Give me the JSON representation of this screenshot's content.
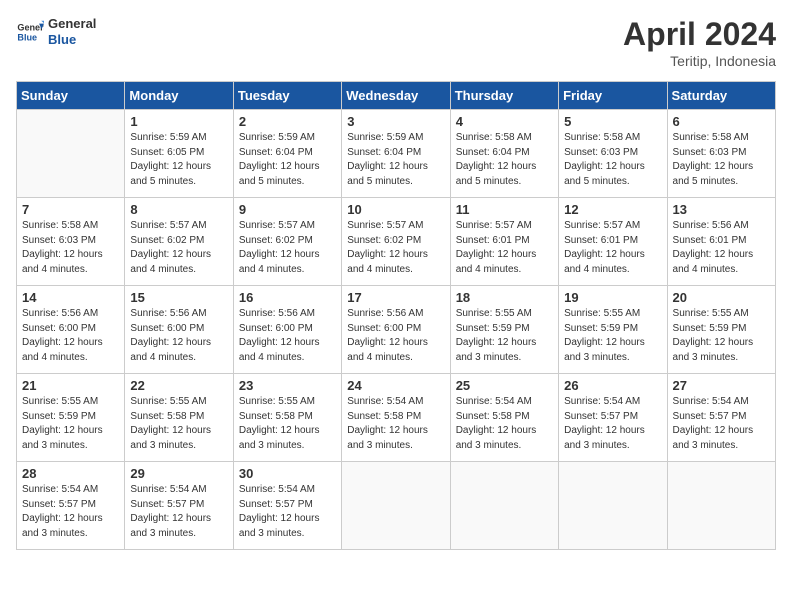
{
  "header": {
    "logo_line1": "General",
    "logo_line2": "Blue",
    "month": "April 2024",
    "location": "Teritip, Indonesia"
  },
  "weekdays": [
    "Sunday",
    "Monday",
    "Tuesday",
    "Wednesday",
    "Thursday",
    "Friday",
    "Saturday"
  ],
  "weeks": [
    [
      {
        "day": "",
        "empty": true
      },
      {
        "day": "1",
        "sunrise": "5:59 AM",
        "sunset": "6:05 PM",
        "daylight": "12 hours and 5 minutes."
      },
      {
        "day": "2",
        "sunrise": "5:59 AM",
        "sunset": "6:04 PM",
        "daylight": "12 hours and 5 minutes."
      },
      {
        "day": "3",
        "sunrise": "5:59 AM",
        "sunset": "6:04 PM",
        "daylight": "12 hours and 5 minutes."
      },
      {
        "day": "4",
        "sunrise": "5:58 AM",
        "sunset": "6:04 PM",
        "daylight": "12 hours and 5 minutes."
      },
      {
        "day": "5",
        "sunrise": "5:58 AM",
        "sunset": "6:03 PM",
        "daylight": "12 hours and 5 minutes."
      },
      {
        "day": "6",
        "sunrise": "5:58 AM",
        "sunset": "6:03 PM",
        "daylight": "12 hours and 5 minutes."
      }
    ],
    [
      {
        "day": "7",
        "sunrise": "5:58 AM",
        "sunset": "6:03 PM",
        "daylight": "12 hours and 4 minutes."
      },
      {
        "day": "8",
        "sunrise": "5:57 AM",
        "sunset": "6:02 PM",
        "daylight": "12 hours and 4 minutes."
      },
      {
        "day": "9",
        "sunrise": "5:57 AM",
        "sunset": "6:02 PM",
        "daylight": "12 hours and 4 minutes."
      },
      {
        "day": "10",
        "sunrise": "5:57 AM",
        "sunset": "6:02 PM",
        "daylight": "12 hours and 4 minutes."
      },
      {
        "day": "11",
        "sunrise": "5:57 AM",
        "sunset": "6:01 PM",
        "daylight": "12 hours and 4 minutes."
      },
      {
        "day": "12",
        "sunrise": "5:57 AM",
        "sunset": "6:01 PM",
        "daylight": "12 hours and 4 minutes."
      },
      {
        "day": "13",
        "sunrise": "5:56 AM",
        "sunset": "6:01 PM",
        "daylight": "12 hours and 4 minutes."
      }
    ],
    [
      {
        "day": "14",
        "sunrise": "5:56 AM",
        "sunset": "6:00 PM",
        "daylight": "12 hours and 4 minutes."
      },
      {
        "day": "15",
        "sunrise": "5:56 AM",
        "sunset": "6:00 PM",
        "daylight": "12 hours and 4 minutes."
      },
      {
        "day": "16",
        "sunrise": "5:56 AM",
        "sunset": "6:00 PM",
        "daylight": "12 hours and 4 minutes."
      },
      {
        "day": "17",
        "sunrise": "5:56 AM",
        "sunset": "6:00 PM",
        "daylight": "12 hours and 4 minutes."
      },
      {
        "day": "18",
        "sunrise": "5:55 AM",
        "sunset": "5:59 PM",
        "daylight": "12 hours and 3 minutes."
      },
      {
        "day": "19",
        "sunrise": "5:55 AM",
        "sunset": "5:59 PM",
        "daylight": "12 hours and 3 minutes."
      },
      {
        "day": "20",
        "sunrise": "5:55 AM",
        "sunset": "5:59 PM",
        "daylight": "12 hours and 3 minutes."
      }
    ],
    [
      {
        "day": "21",
        "sunrise": "5:55 AM",
        "sunset": "5:59 PM",
        "daylight": "12 hours and 3 minutes."
      },
      {
        "day": "22",
        "sunrise": "5:55 AM",
        "sunset": "5:58 PM",
        "daylight": "12 hours and 3 minutes."
      },
      {
        "day": "23",
        "sunrise": "5:55 AM",
        "sunset": "5:58 PM",
        "daylight": "12 hours and 3 minutes."
      },
      {
        "day": "24",
        "sunrise": "5:54 AM",
        "sunset": "5:58 PM",
        "daylight": "12 hours and 3 minutes."
      },
      {
        "day": "25",
        "sunrise": "5:54 AM",
        "sunset": "5:58 PM",
        "daylight": "12 hours and 3 minutes."
      },
      {
        "day": "26",
        "sunrise": "5:54 AM",
        "sunset": "5:57 PM",
        "daylight": "12 hours and 3 minutes."
      },
      {
        "day": "27",
        "sunrise": "5:54 AM",
        "sunset": "5:57 PM",
        "daylight": "12 hours and 3 minutes."
      }
    ],
    [
      {
        "day": "28",
        "sunrise": "5:54 AM",
        "sunset": "5:57 PM",
        "daylight": "12 hours and 3 minutes."
      },
      {
        "day": "29",
        "sunrise": "5:54 AM",
        "sunset": "5:57 PM",
        "daylight": "12 hours and 3 minutes."
      },
      {
        "day": "30",
        "sunrise": "5:54 AM",
        "sunset": "5:57 PM",
        "daylight": "12 hours and 3 minutes."
      },
      {
        "day": "",
        "empty": true
      },
      {
        "day": "",
        "empty": true
      },
      {
        "day": "",
        "empty": true
      },
      {
        "day": "",
        "empty": true
      }
    ]
  ]
}
